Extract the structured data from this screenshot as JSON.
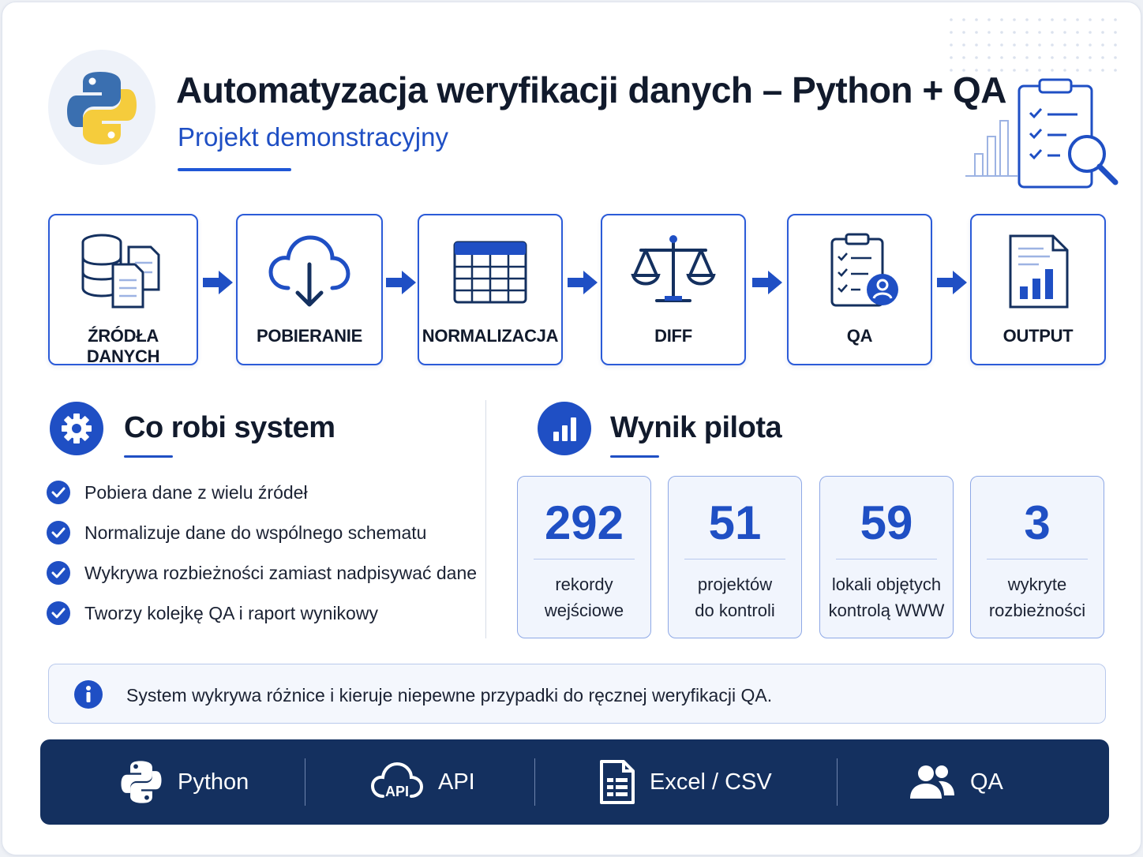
{
  "header": {
    "title": "Automatyzacja weryfikacji danych – Python + QA",
    "subtitle": "Projekt demonstracyjny"
  },
  "pipeline": [
    {
      "label": "ŹRÓDŁA DANYCH",
      "icon": "database-documents-icon"
    },
    {
      "label": "POBIERANIE",
      "icon": "cloud-download-icon"
    },
    {
      "label": "NORMALIZACJA",
      "icon": "table-icon"
    },
    {
      "label": "DIFF",
      "icon": "scales-icon"
    },
    {
      "label": "QA",
      "icon": "clipboard-user-icon"
    },
    {
      "label": "OUTPUT",
      "icon": "report-chart-icon"
    }
  ],
  "system": {
    "title": "Co robi system",
    "features": [
      "Pobiera dane z wielu źródeł",
      "Normalizuje dane do wspólnego schematu",
      "Wykrywa rozbieżności zamiast nadpisywać dane",
      "Tworzy kolejkę QA i raport wynikowy"
    ]
  },
  "pilot": {
    "title": "Wynik pilota",
    "stats": [
      {
        "value": "292",
        "line1": "rekordy",
        "line2": "wejściowe"
      },
      {
        "value": "51",
        "line1": "projektów",
        "line2": "do kontroli"
      },
      {
        "value": "59",
        "line1": "lokali objętych",
        "line2": "kontrolą WWW"
      },
      {
        "value": "3",
        "line1": "wykryte",
        "line2": "rozbieżności"
      }
    ]
  },
  "info": {
    "text": "System wykrywa różnice i kieruje niepewne przypadki do ręcznej weryfikacji QA."
  },
  "footer": {
    "items": [
      {
        "label": "Python",
        "icon": "python-icon"
      },
      {
        "label": "API",
        "icon": "cloud-api-icon",
        "icon_text": "API"
      },
      {
        "label": "Excel / CSV",
        "icon": "spreadsheet-file-icon"
      },
      {
        "label": "QA",
        "icon": "users-icon"
      }
    ]
  },
  "colors": {
    "primary": "#1f4fc4",
    "python_blue": "#3a6fb0",
    "python_yellow": "#f5cc3c",
    "footer_bg": "#14305f"
  }
}
